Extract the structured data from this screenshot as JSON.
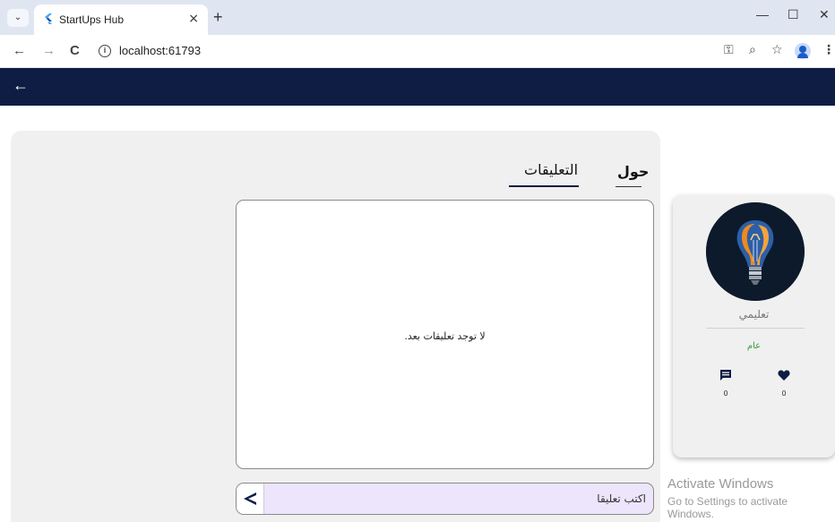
{
  "browser": {
    "tab_title": "StartUps Hub",
    "tab_close": "×",
    "new_tab": "+",
    "minimize": "—",
    "maximize": "☐",
    "close": "✕",
    "back": "←",
    "forward": "→",
    "reload": "C",
    "info": "i",
    "url": "localhost:61793"
  },
  "appbar": {
    "back": "←",
    "bg_color": "#0f1d45"
  },
  "tabs": {
    "about": "حول",
    "comments": "التعليقات"
  },
  "comments": {
    "empty_message": "لا توجد تعليقات بعد.",
    "input_placeholder": "اكتب تعليقا"
  },
  "card": {
    "name": "تعليمي",
    "category": "عام",
    "comment_count": "0",
    "like_count": "0"
  },
  "watermark": {
    "line1": "Activate Windows",
    "line2": "Go to Settings to activate Windows."
  }
}
